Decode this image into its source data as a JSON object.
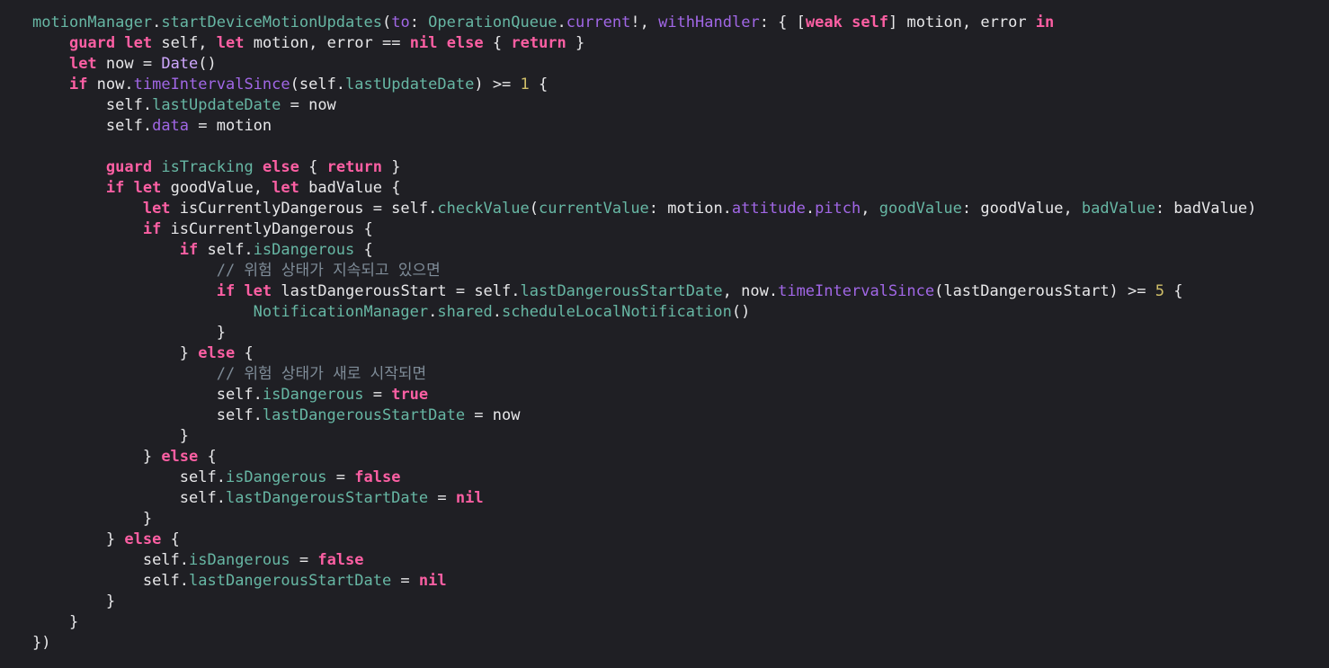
{
  "editor": {
    "theme_colors": {
      "background": "#1f1f24",
      "keyword": "#fc5fa3",
      "function": "#67b7a4",
      "property": "#a167e6",
      "plain": "#e8e8ea",
      "number": "#d0bf69",
      "comment": "#7f8c98",
      "type": "#d0a8ff"
    },
    "lines": [
      {
        "indent": 0,
        "tokens": [
          [
            "fn",
            "motionManager"
          ],
          [
            "p",
            "."
          ],
          [
            "fn",
            "startDeviceMotionUpdates"
          ],
          [
            "p",
            "("
          ],
          [
            "prop",
            "to"
          ],
          [
            "p",
            ": "
          ],
          [
            "fn",
            "OperationQueue"
          ],
          [
            "p",
            "."
          ],
          [
            "prop",
            "current"
          ],
          [
            "p",
            "!, "
          ],
          [
            "prop",
            "withHandler"
          ],
          [
            "p",
            ": { ["
          ],
          [
            "kw",
            "weak"
          ],
          [
            "p",
            " "
          ],
          [
            "kw",
            "self"
          ],
          [
            "p",
            "] motion, error "
          ],
          [
            "kw",
            "in"
          ]
        ]
      },
      {
        "indent": 1,
        "tokens": [
          [
            "kw",
            "guard"
          ],
          [
            "p",
            " "
          ],
          [
            "kw",
            "let"
          ],
          [
            "p",
            " self, "
          ],
          [
            "kw",
            "let"
          ],
          [
            "p",
            " motion, error == "
          ],
          [
            "kw",
            "nil"
          ],
          [
            "p",
            " "
          ],
          [
            "kw",
            "else"
          ],
          [
            "p",
            " { "
          ],
          [
            "kw",
            "return"
          ],
          [
            "p",
            " }"
          ]
        ]
      },
      {
        "indent": 1,
        "tokens": [
          [
            "kw",
            "let"
          ],
          [
            "p",
            " now = "
          ],
          [
            "ty",
            "Date"
          ],
          [
            "p",
            "()"
          ]
        ]
      },
      {
        "indent": 1,
        "tokens": [
          [
            "kw",
            "if"
          ],
          [
            "p",
            " now."
          ],
          [
            "prop",
            "timeIntervalSince"
          ],
          [
            "p",
            "(self."
          ],
          [
            "fn",
            "lastUpdateDate"
          ],
          [
            "p",
            ") >= "
          ],
          [
            "num",
            "1"
          ],
          [
            "p",
            " {"
          ]
        ]
      },
      {
        "indent": 2,
        "tokens": [
          [
            "p",
            "self."
          ],
          [
            "fn",
            "lastUpdateDate"
          ],
          [
            "p",
            " = now"
          ]
        ]
      },
      {
        "indent": 2,
        "tokens": [
          [
            "p",
            "self."
          ],
          [
            "prop",
            "data"
          ],
          [
            "p",
            " = motion"
          ]
        ]
      },
      {
        "indent": 0,
        "tokens": []
      },
      {
        "indent": 2,
        "tokens": [
          [
            "kw",
            "guard"
          ],
          [
            "p",
            " "
          ],
          [
            "fn",
            "isTracking"
          ],
          [
            "p",
            " "
          ],
          [
            "kw",
            "else"
          ],
          [
            "p",
            " { "
          ],
          [
            "kw",
            "return"
          ],
          [
            "p",
            " }"
          ]
        ]
      },
      {
        "indent": 2,
        "tokens": [
          [
            "kw",
            "if"
          ],
          [
            "p",
            " "
          ],
          [
            "kw",
            "let"
          ],
          [
            "p",
            " goodValue, "
          ],
          [
            "kw",
            "let"
          ],
          [
            "p",
            " badValue {"
          ]
        ]
      },
      {
        "indent": 3,
        "tokens": [
          [
            "kw",
            "let"
          ],
          [
            "p",
            " isCurrentlyDangerous = self."
          ],
          [
            "fn",
            "checkValue"
          ],
          [
            "p",
            "("
          ],
          [
            "fn",
            "currentValue"
          ],
          [
            "p",
            ": motion."
          ],
          [
            "prop",
            "attitude"
          ],
          [
            "p",
            "."
          ],
          [
            "prop",
            "pitch"
          ],
          [
            "p",
            ", "
          ],
          [
            "fn",
            "goodValue"
          ],
          [
            "p",
            ": goodValue, "
          ],
          [
            "fn",
            "badValue"
          ],
          [
            "p",
            ": badValue)"
          ]
        ]
      },
      {
        "indent": 3,
        "tokens": [
          [
            "kw",
            "if"
          ],
          [
            "p",
            " isCurrentlyDangerous {"
          ]
        ]
      },
      {
        "indent": 4,
        "tokens": [
          [
            "kw",
            "if"
          ],
          [
            "p",
            " self."
          ],
          [
            "fn",
            "isDangerous"
          ],
          [
            "p",
            " {"
          ]
        ]
      },
      {
        "indent": 5,
        "tokens": [
          [
            "cm",
            "// 위험 상태가 지속되고 있으면"
          ]
        ]
      },
      {
        "indent": 5,
        "tokens": [
          [
            "kw",
            "if"
          ],
          [
            "p",
            " "
          ],
          [
            "kw",
            "let"
          ],
          [
            "p",
            " lastDangerousStart = self."
          ],
          [
            "fn",
            "lastDangerousStartDate"
          ],
          [
            "p",
            ", now."
          ],
          [
            "prop",
            "timeIntervalSince"
          ],
          [
            "p",
            "(lastDangerousStart) >= "
          ],
          [
            "num",
            "5"
          ],
          [
            "p",
            " {"
          ]
        ]
      },
      {
        "indent": 6,
        "tokens": [
          [
            "fn",
            "NotificationManager"
          ],
          [
            "p",
            "."
          ],
          [
            "fn",
            "shared"
          ],
          [
            "p",
            "."
          ],
          [
            "fn",
            "scheduleLocalNotification"
          ],
          [
            "p",
            "()"
          ]
        ]
      },
      {
        "indent": 5,
        "tokens": [
          [
            "p",
            "}"
          ]
        ]
      },
      {
        "indent": 4,
        "tokens": [
          [
            "p",
            "} "
          ],
          [
            "kw",
            "else"
          ],
          [
            "p",
            " {"
          ]
        ]
      },
      {
        "indent": 5,
        "tokens": [
          [
            "cm",
            "// 위험 상태가 새로 시작되면"
          ]
        ]
      },
      {
        "indent": 5,
        "tokens": [
          [
            "p",
            "self."
          ],
          [
            "fn",
            "isDangerous"
          ],
          [
            "p",
            " = "
          ],
          [
            "kw",
            "true"
          ]
        ]
      },
      {
        "indent": 5,
        "tokens": [
          [
            "p",
            "self."
          ],
          [
            "fn",
            "lastDangerousStartDate"
          ],
          [
            "p",
            " = now"
          ]
        ]
      },
      {
        "indent": 4,
        "tokens": [
          [
            "p",
            "}"
          ]
        ]
      },
      {
        "indent": 3,
        "tokens": [
          [
            "p",
            "} "
          ],
          [
            "kw",
            "else"
          ],
          [
            "p",
            " {"
          ]
        ]
      },
      {
        "indent": 4,
        "tokens": [
          [
            "p",
            "self."
          ],
          [
            "fn",
            "isDangerous"
          ],
          [
            "p",
            " = "
          ],
          [
            "kw",
            "false"
          ]
        ]
      },
      {
        "indent": 4,
        "tokens": [
          [
            "p",
            "self."
          ],
          [
            "fn",
            "lastDangerousStartDate"
          ],
          [
            "p",
            " = "
          ],
          [
            "kw",
            "nil"
          ]
        ]
      },
      {
        "indent": 3,
        "tokens": [
          [
            "p",
            "}"
          ]
        ]
      },
      {
        "indent": 2,
        "tokens": [
          [
            "p",
            "} "
          ],
          [
            "kw",
            "else"
          ],
          [
            "p",
            " {"
          ]
        ]
      },
      {
        "indent": 3,
        "tokens": [
          [
            "p",
            "self."
          ],
          [
            "fn",
            "isDangerous"
          ],
          [
            "p",
            " = "
          ],
          [
            "kw",
            "false"
          ]
        ]
      },
      {
        "indent": 3,
        "tokens": [
          [
            "p",
            "self."
          ],
          [
            "fn",
            "lastDangerousStartDate"
          ],
          [
            "p",
            " = "
          ],
          [
            "kw",
            "nil"
          ]
        ]
      },
      {
        "indent": 2,
        "tokens": [
          [
            "p",
            "}"
          ]
        ]
      },
      {
        "indent": 1,
        "tokens": [
          [
            "p",
            "}"
          ]
        ]
      },
      {
        "indent": 0,
        "tokens": [
          [
            "p",
            "})"
          ]
        ]
      }
    ]
  }
}
